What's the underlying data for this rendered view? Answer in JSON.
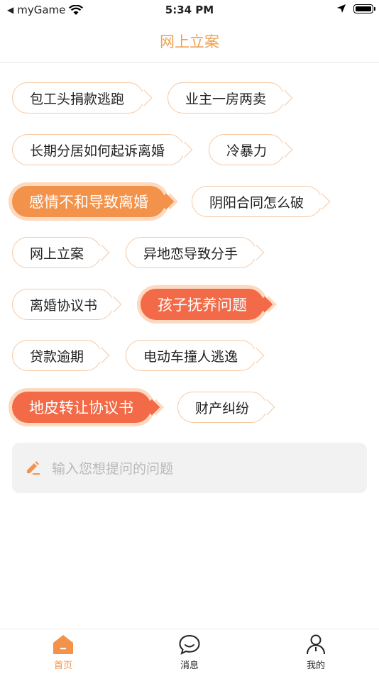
{
  "status_bar": {
    "back_app": "myGame",
    "time": "5:34 PM"
  },
  "nav": {
    "title": "网上立案"
  },
  "tags": [
    "包工头捐款逃跑",
    "业主一房两卖",
    "长期分居如何起诉离婚",
    "冷暴力",
    "感情不和导致离婚",
    "阴阳合同怎么破",
    "网上立案",
    "异地恋导致分手",
    "离婚协议书",
    "孩子抚养问题",
    "贷款逾期",
    "电动车撞人逃逸",
    "地皮转让协议书",
    "财产纠纷"
  ],
  "ask": {
    "placeholder": "输入您想提问的问题"
  },
  "tabs": [
    {
      "label": "首页",
      "icon": "home-icon",
      "active": true
    },
    {
      "label": "消息",
      "icon": "chat-bubble-icon",
      "active": false
    },
    {
      "label": "我的",
      "icon": "person-icon",
      "active": false
    }
  ],
  "colors": {
    "accent_orange": "#f3924a",
    "accent_red": "#f26a47",
    "title": "#f0a050",
    "tag_border": "#f4c9a6"
  }
}
